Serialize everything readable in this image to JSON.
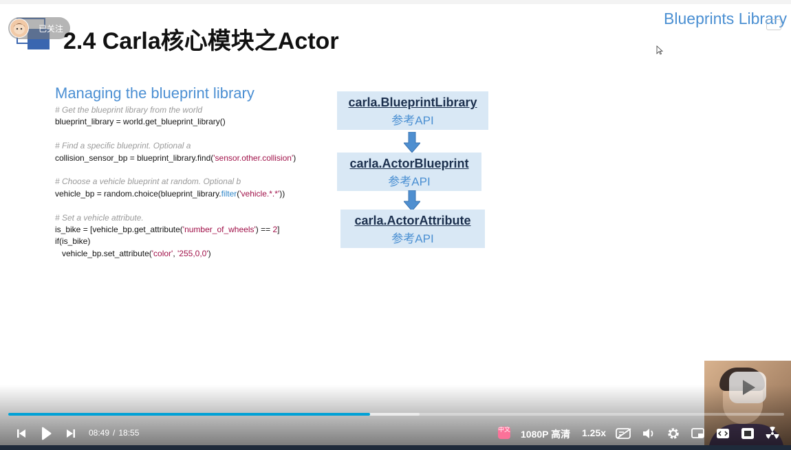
{
  "follow_badge": {
    "label": "已关注"
  },
  "slide": {
    "title": "2.4 Carla核心模块之Actor",
    "corner_title": "Blueprints Library",
    "code_heading": "Managing the blueprint library",
    "code_lines": [
      [
        {
          "t": "# Get the blueprint library from the world",
          "c": "cm"
        }
      ],
      [
        {
          "t": "blueprint_library = world.get_blueprint_library()",
          "c": ""
        }
      ],
      [],
      [
        {
          "t": "# Find a specific blueprint. Optional a",
          "c": "cm"
        }
      ],
      [
        {
          "t": "collision_sensor_bp = blueprint_library.find(",
          "c": ""
        },
        {
          "t": "'sensor.other.collision'",
          "c": "str"
        },
        {
          "t": ")",
          "c": ""
        }
      ],
      [],
      [
        {
          "t": "# Choose a vehicle blueprint at random. Optional b",
          "c": "cm"
        }
      ],
      [
        {
          "t": "vehicle_bp = random.choice(blueprint_library.",
          "c": ""
        },
        {
          "t": "filter",
          "c": "fn"
        },
        {
          "t": "(",
          "c": ""
        },
        {
          "t": "'vehicle.*.*'",
          "c": "str"
        },
        {
          "t": "))",
          "c": ""
        }
      ],
      [],
      [
        {
          "t": "# Set a vehicle attribute.",
          "c": "cm"
        }
      ],
      [
        {
          "t": "is_bike = [vehicle_bp.get_attribute(",
          "c": ""
        },
        {
          "t": "'number_of_wheels'",
          "c": "str"
        },
        {
          "t": ") == ",
          "c": ""
        },
        {
          "t": "2",
          "c": "num"
        },
        {
          "t": "]",
          "c": ""
        }
      ],
      [
        {
          "t": "if(is_bike)",
          "c": ""
        }
      ],
      [
        {
          "t": "   vehicle_bp.set_attribute(",
          "c": ""
        },
        {
          "t": "'color'",
          "c": "str"
        },
        {
          "t": ", ",
          "c": ""
        },
        {
          "t": "'255,0,0'",
          "c": "str"
        },
        {
          "t": ")",
          "c": ""
        }
      ]
    ],
    "flow": [
      {
        "name": "carla.BlueprintLibrary",
        "link": "参考API"
      },
      {
        "name": "carla.ActorBlueprint",
        "link": "参考API"
      },
      {
        "name": "carla.ActorAttribute",
        "link": "参考API"
      }
    ]
  },
  "player": {
    "current_time": "08:49",
    "time_separator": "/",
    "total_time": "18:55",
    "played_fraction": 0.466,
    "buffered_fraction": 0.53,
    "quality": "1080P 高清",
    "speed": "1.25x",
    "subtitle_badge": "中文",
    "accent_color": "#00a1d6",
    "icons": [
      "prev-icon",
      "play-icon",
      "next-icon",
      "subtitle-icon",
      "danmaku-off-icon",
      "volume-icon",
      "settings-icon",
      "pip-icon",
      "widescreen-icon",
      "fullscreen-icon",
      "radiation-icon"
    ]
  }
}
